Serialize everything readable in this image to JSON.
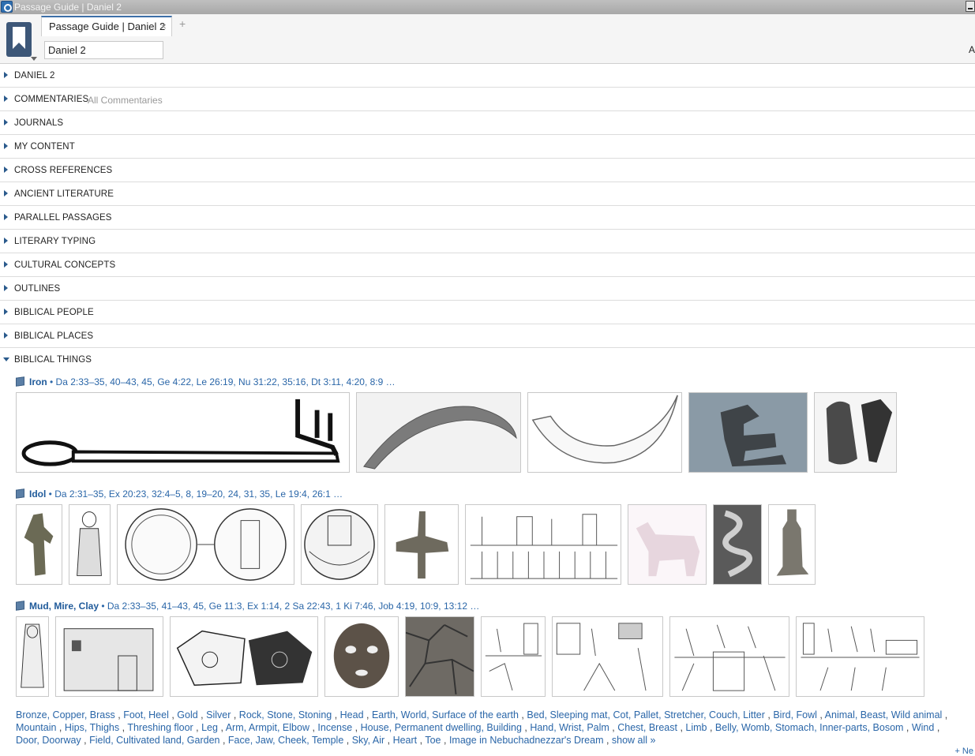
{
  "window": {
    "title": "Passage Guide | Daniel 2"
  },
  "tabs": [
    {
      "label": "Passage Guide | Daniel 2",
      "close": "×"
    }
  ],
  "tab_add": "+",
  "reference_input": {
    "value": "Daniel 2"
  },
  "edge_char": "A",
  "sections": [
    {
      "label": "DANIEL 2"
    },
    {
      "label": "COMMENTARIES",
      "sub": "All Commentaries"
    },
    {
      "label": "JOURNALS"
    },
    {
      "label": "MY CONTENT"
    },
    {
      "label": "CROSS REFERENCES"
    },
    {
      "label": "ANCIENT LITERATURE"
    },
    {
      "label": "PARALLEL PASSAGES"
    },
    {
      "label": "LITERARY TYPING"
    },
    {
      "label": "CULTURAL CONCEPTS"
    },
    {
      "label": "OUTLINES"
    },
    {
      "label": "BIBLICAL PEOPLE"
    },
    {
      "label": "BIBLICAL PLACES"
    },
    {
      "label": "BIBLICAL THINGS"
    }
  ],
  "things": [
    {
      "name": "Iron",
      "refs": " • Da 2:33–35, 40–43, 45, Ge 4:22, Le 26:19, Nu 31:22, 35:16, Dt 3:11, 4:20, 8:9 …"
    },
    {
      "name": "Idol",
      "refs": " • Da 2:31–35, Ex 20:23, 32:4–5, 8, 19–20, 24, 31, 35, Le 19:4, 26:1 …"
    },
    {
      "name": "Mud, Mire, Clay",
      "refs": " • Da 2:33–35, 41–43, 45, Ge 11:3, Ex 1:14, 2 Sa 22:43, 1 Ki 7:46, Job 4:19, 10:9, 13:12 …"
    }
  ],
  "more_things": [
    "Bronze, Copper, Brass",
    "Foot, Heel",
    "Gold",
    "Silver",
    "Rock, Stone, Stoning",
    "Head",
    "Earth, World, Surface of the earth",
    "Bed, Sleeping mat, Cot, Pallet, Stretcher, Couch, Litter",
    "Bird, Fowl",
    "Animal, Beast, Wild animal",
    "Mountain",
    "Hips, Thighs",
    "Threshing floor",
    "Leg",
    "Arm, Armpit, Elbow",
    "Incense",
    "House, Permanent dwelling, Building",
    "Hand, Wrist, Palm",
    "Chest, Breast",
    "Limb",
    "Belly, Womb, Stomach, Inner-parts, Bosom",
    "Wind",
    "Door, Doorway",
    "Field, Cultivated land, Garden",
    "Face, Jaw, Cheek, Temple",
    "Sky, Air",
    "Heart",
    "Toe",
    "Image in Nebuchadnezzar's Dream"
  ],
  "show_all": "show all »",
  "corner_link": "+ Ne"
}
